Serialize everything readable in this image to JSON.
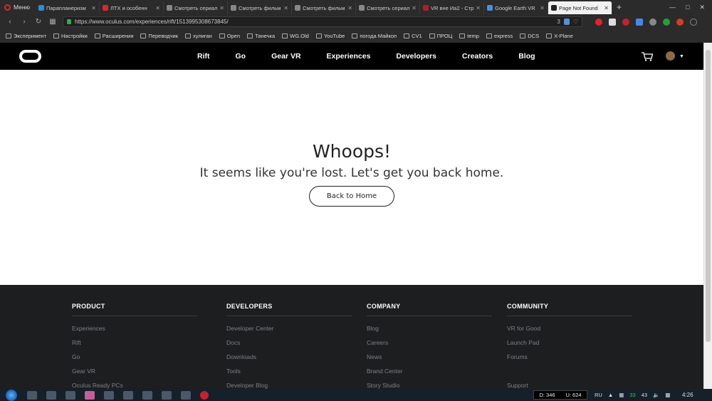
{
  "browser": {
    "menu_label": "Меню",
    "tabs": [
      {
        "title": "Парапланеризм",
        "color": "#2b8fd6"
      },
      {
        "title": "ЛТХ и особенн",
        "color": "#e0242e"
      },
      {
        "title": "Смотреть сериал",
        "color": "#888888"
      },
      {
        "title": "Смотреть фильм",
        "color": "#888888"
      },
      {
        "title": "Смотреть фильм",
        "color": "#888888"
      },
      {
        "title": "Смотреть сериал",
        "color": "#888888"
      },
      {
        "title": "VR вне Иа2 - Стр",
        "color": "#b01e2a"
      },
      {
        "title": "Google Earth VR",
        "color": "#4a90e2"
      },
      {
        "title": "Page Not Found",
        "color": "#222222",
        "active": true
      }
    ],
    "new_tab": "+",
    "url": "https://www.oculus.com/experiences/rift/1513995308673845/",
    "url_badge": "3",
    "bookmarks": [
      "Эксперимент",
      "Настройки",
      "Расширения",
      "Переводчик",
      "хулиган",
      "Open",
      "Танечка",
      "WG.Old",
      "YouTube",
      "погода Майкоп",
      "CV1",
      "ПРОЦ",
      "temp",
      "express",
      "DCS",
      "X-Plane"
    ]
  },
  "site": {
    "nav": [
      "Rift",
      "Go",
      "Gear VR",
      "Experiences",
      "Developers",
      "Creators",
      "Blog"
    ]
  },
  "main": {
    "title": "Whoops!",
    "subtitle": "It seems like you're lost. Let's get you back home.",
    "button": "Back to Home"
  },
  "footer": {
    "columns": [
      {
        "heading": "PRODUCT",
        "links": [
          "Experiences",
          "Rift",
          "Go",
          "Gear VR",
          "Oculus Ready PCs"
        ]
      },
      {
        "heading": "DEVELOPERS",
        "links": [
          "Developer Center",
          "Docs",
          "Downloads",
          "Tools",
          "Developer Blog"
        ]
      },
      {
        "heading": "COMPANY",
        "links": [
          "Blog",
          "Careers",
          "News",
          "Brand Center",
          "Story Studio"
        ]
      },
      {
        "heading": "COMMUNITY",
        "links": [
          "VR for Good",
          "Launch Pad",
          "Forums",
          "",
          "Support"
        ]
      }
    ]
  },
  "taskbar": {
    "download": "D: 346",
    "upload": "U: 624",
    "lang": "RU",
    "tray_num1": "33",
    "tray_num2": "43",
    "time": "4:26"
  }
}
